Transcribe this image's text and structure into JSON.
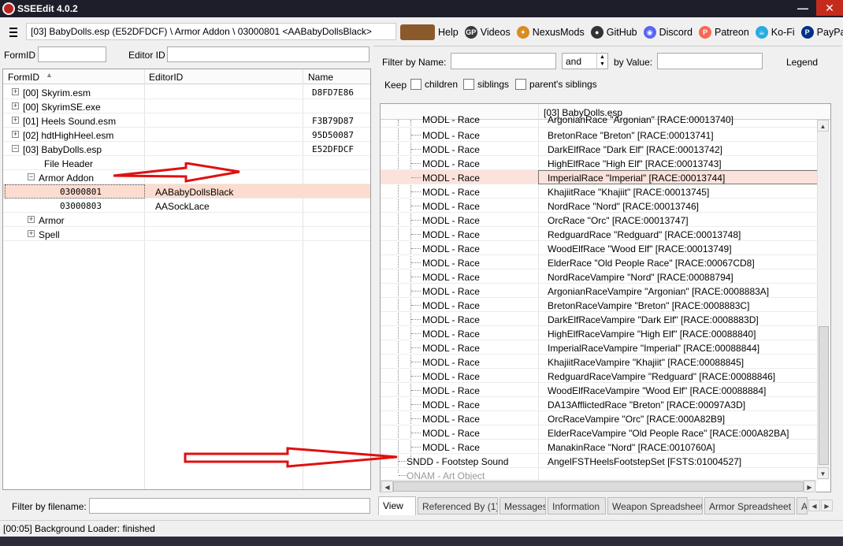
{
  "window": {
    "title": "SSEEdit 4.0.2",
    "minimize": "—",
    "close": "✕"
  },
  "header": {
    "path": "[03] BabyDolls.esp (E52DFDCF) \\ Armor Addon \\ 03000801 <AABabyDollsBlack>",
    "links": [
      {
        "label": "Help",
        "icon": "book-icon",
        "color": "#8b5a2b",
        "glyph": ""
      },
      {
        "label": "Videos",
        "icon": "gp-icon",
        "color": "#3a3a3a",
        "glyph": "GP"
      },
      {
        "label": "NexusMods",
        "icon": "nexus-icon",
        "color": "#d98c1f",
        "glyph": "✦"
      },
      {
        "label": "GitHub",
        "icon": "github-icon",
        "color": "#333333",
        "glyph": "●"
      },
      {
        "label": "Discord",
        "icon": "discord-icon",
        "color": "#5865f2",
        "glyph": "◉"
      },
      {
        "label": "Patreon",
        "icon": "patreon-icon",
        "color": "#f96854",
        "glyph": "P"
      },
      {
        "label": "Ko-Fi",
        "icon": "kofi-icon",
        "color": "#29abe0",
        "glyph": "☕"
      },
      {
        "label": "PayPal",
        "icon": "paypal-icon",
        "color": "#003087",
        "glyph": "P"
      }
    ]
  },
  "left": {
    "formid_label": "FormID",
    "editorid_label": "Editor ID",
    "columns": [
      "FormID",
      "EditorID",
      "Name"
    ],
    "rows": [
      {
        "text": "[00] Skyrim.esm",
        "editorid": "",
        "name": "D8FD7E86",
        "expander": "+",
        "selected": false
      },
      {
        "text": "[00] SkyrimSE.exe",
        "editorid": "",
        "name": "",
        "expander": "+",
        "selected": false
      },
      {
        "text": "[01] Heels Sound.esm",
        "editorid": "",
        "name": "F3B79D87",
        "expander": "+",
        "selected": false
      },
      {
        "text": "[02] hdtHighHeel.esm",
        "editorid": "",
        "name": "95D50087",
        "expander": "+",
        "selected": false
      },
      {
        "text": "[03] BabyDolls.esp",
        "editorid": "",
        "name": "E52DFDCF",
        "expander": "−",
        "selected": false
      },
      {
        "text": "File Header",
        "editorid": "",
        "name": "",
        "expander": "",
        "selected": false
      },
      {
        "text": "Armor Addon",
        "editorid": "",
        "name": "",
        "expander": "−",
        "selected": false
      },
      {
        "text": "03000801",
        "editorid": "AABabyDollsBlack",
        "name": "",
        "expander": "",
        "selected": true
      },
      {
        "text": "03000803",
        "editorid": "AASockLace",
        "name": "",
        "expander": "",
        "selected": false
      },
      {
        "text": "Armor",
        "editorid": "",
        "name": "",
        "expander": "+",
        "selected": false
      },
      {
        "text": "Spell",
        "editorid": "",
        "name": "",
        "expander": "+",
        "selected": false
      }
    ],
    "filter_label": "Filter by filename:"
  },
  "right": {
    "filter_name_label": "Filter by Name:",
    "operator": "and",
    "filter_value_label": "by Value:",
    "legend_label": "Legend",
    "keep_label": "Keep",
    "keep_options": [
      "children",
      "siblings",
      "parent's siblings"
    ],
    "column_header": "[03] BabyDolls.esp",
    "partial_row_value": "ArgonianRace \"Argonian\" [RACE:00013740]",
    "rows": [
      {
        "label": "MODL - Race",
        "value": "BretonRace \"Breton\" [RACE:00013741]"
      },
      {
        "label": "MODL - Race",
        "value": "DarkElfRace \"Dark Elf\" [RACE:00013742]"
      },
      {
        "label": "MODL - Race",
        "value": "HighElfRace \"High Elf\" [RACE:00013743]"
      },
      {
        "label": "MODL - Race",
        "value": "ImperialRace \"Imperial\" [RACE:00013744]"
      },
      {
        "label": "MODL - Race",
        "value": "KhajiitRace \"Khajiit\" [RACE:00013745]"
      },
      {
        "label": "MODL - Race",
        "value": "NordRace \"Nord\" [RACE:00013746]"
      },
      {
        "label": "MODL - Race",
        "value": "OrcRace \"Orc\" [RACE:00013747]"
      },
      {
        "label": "MODL - Race",
        "value": "RedguardRace \"Redguard\" [RACE:00013748]"
      },
      {
        "label": "MODL - Race",
        "value": "WoodElfRace \"Wood Elf\" [RACE:00013749]"
      },
      {
        "label": "MODL - Race",
        "value": "ElderRace \"Old People Race\" [RACE:00067CD8]"
      },
      {
        "label": "MODL - Race",
        "value": "NordRaceVampire \"Nord\" [RACE:00088794]"
      },
      {
        "label": "MODL - Race",
        "value": "ArgonianRaceVampire \"Argonian\" [RACE:0008883A]"
      },
      {
        "label": "MODL - Race",
        "value": "BretonRaceVampire \"Breton\" [RACE:0008883C]"
      },
      {
        "label": "MODL - Race",
        "value": "DarkElfRaceVampire \"Dark Elf\" [RACE:0008883D]"
      },
      {
        "label": "MODL - Race",
        "value": "HighElfRaceVampire \"High Elf\" [RACE:00088840]"
      },
      {
        "label": "MODL - Race",
        "value": "ImperialRaceVampire \"Imperial\" [RACE:00088844]"
      },
      {
        "label": "MODL - Race",
        "value": "KhajiitRaceVampire \"Khajiit\" [RACE:00088845]"
      },
      {
        "label": "MODL - Race",
        "value": "RedguardRaceVampire \"Redguard\" [RACE:00088846]"
      },
      {
        "label": "MODL - Race",
        "value": "WoodElfRaceVampire \"Wood Elf\" [RACE:00088884]"
      },
      {
        "label": "MODL - Race",
        "value": "DA13AfflictedRace \"Breton\" [RACE:00097A3D]"
      },
      {
        "label": "MODL - Race",
        "value": "OrcRaceVampire \"Orc\" [RACE:000A82B9]"
      },
      {
        "label": "MODL - Race",
        "value": "ElderRaceVampire \"Old People Race\" [RACE:000A82BA]"
      },
      {
        "label": "MODL - Race",
        "value": "ManakinRace \"Nord\" [RACE:0010760A]"
      }
    ],
    "sndd": {
      "label": "SNDD - Footstep Sound",
      "value": "AngelFSTHeelsFootstepSet [FSTS:01004527]"
    },
    "onam": {
      "label": "ONAM - Art Object",
      "value": ""
    },
    "tabs": [
      "View",
      "Referenced By (1)",
      "Messages",
      "Information",
      "Weapon Spreadsheet",
      "Armor Spreadsheet",
      "A"
    ]
  },
  "status": {
    "text": "[00:05] Background Loader: finished"
  },
  "colors": {
    "selection": "#fbdccf",
    "annotation_arrow": "#e01010"
  }
}
